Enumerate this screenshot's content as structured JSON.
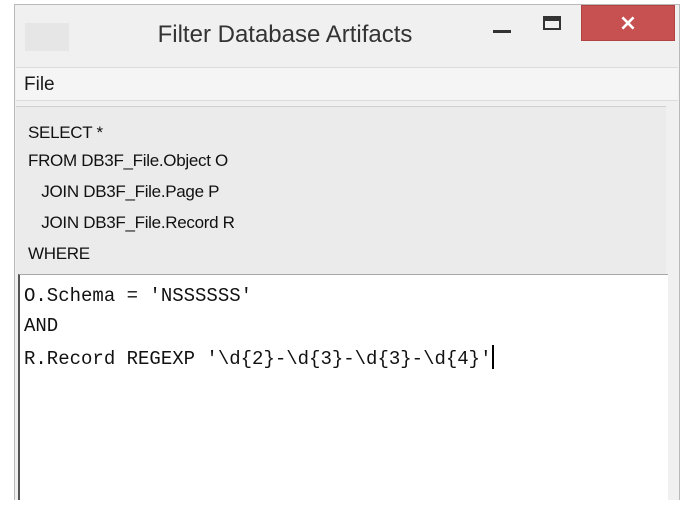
{
  "window": {
    "title": "Filter Database Artifacts",
    "controls": {
      "minimize": "minimize",
      "maximize": "maximize",
      "close": "×"
    }
  },
  "menu": {
    "file_label": "File"
  },
  "query": {
    "header_lines": [
      "SELECT *",
      "FROM DB3F_File.Object O",
      "   JOIN DB3F_File.Page P",
      "   JOIN DB3F_File.Record R",
      "WHERE"
    ],
    "editor_lines": [
      "O.Schema = 'NSSSSSS'",
      "AND",
      "R.Record REGEXP '\\d{2}-\\d{3}-\\d{3}-\\d{4}'"
    ]
  },
  "colors": {
    "close_button": "#c75050",
    "window_bg": "#f0f0f0",
    "editor_bg": "#ffffff"
  },
  "icons": [
    "app-icon",
    "minimize-icon",
    "maximize-icon",
    "close-icon"
  ]
}
